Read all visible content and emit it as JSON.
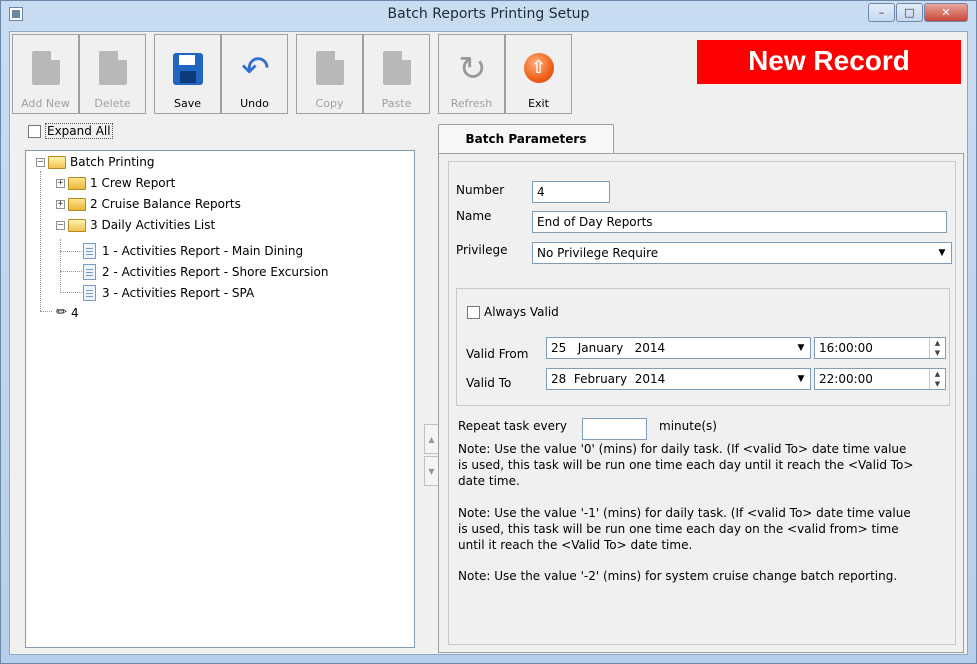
{
  "window": {
    "title": "Batch Reports Printing Setup"
  },
  "toolbar": {
    "buttons": [
      {
        "label": "Add New",
        "icon": "add-new-icon",
        "enabled": false
      },
      {
        "label": "Delete",
        "icon": "delete-icon",
        "enabled": false
      },
      {
        "label": "Save",
        "icon": "save-icon",
        "enabled": true
      },
      {
        "label": "Undo",
        "icon": "undo-icon",
        "enabled": true
      },
      {
        "label": "Copy",
        "icon": "copy-icon",
        "enabled": false
      },
      {
        "label": "Paste",
        "icon": "paste-icon",
        "enabled": false
      },
      {
        "label": "Refresh",
        "icon": "refresh-icon",
        "enabled": false
      },
      {
        "label": "Exit",
        "icon": "exit-icon",
        "enabled": true
      }
    ]
  },
  "status_banner": {
    "text": "New Record",
    "color": "#ff0000"
  },
  "tree_panel": {
    "expand_all_label": "Expand All",
    "root": "Batch Printing",
    "nodes": [
      "1 Crew Report",
      "2 Cruise Balance Reports",
      "3 Daily Activities List",
      "1 - Activities Report - Main Dining",
      "2 - Activities Report - Shore Excursion",
      "3 - Activities Report - SPA",
      "4"
    ]
  },
  "tab": {
    "label": "Batch Parameters"
  },
  "form": {
    "number_label": "Number",
    "number_value": "4",
    "name_label": "Name",
    "name_value": "End of Day Reports",
    "privilege_label": "Privilege",
    "privilege_value": "No Privilege Require",
    "always_valid_label": "Always Valid",
    "valid_from_label": "Valid From",
    "valid_from_date": "25   January   2014",
    "valid_from_time": "16:00:00",
    "valid_to_label": "Valid To",
    "valid_to_date": "28  February  2014",
    "valid_to_time": "22:00:00",
    "repeat_label": "Repeat task every",
    "repeat_value": "",
    "repeat_unit": "minute(s)",
    "note1": "Note: Use the value '0' (mins) for daily task. (If <valid To> date time value is used, this task will be run one time each day until it reach the <Valid To> date time.",
    "note2": "Note: Use the value '-1' (mins) for daily task. (If <valid To> date time value is used, this task will be run one time each day on the <valid from> time until it reach the <Valid To> date time.",
    "note3": "Note: Use the value '-2' (mins) for system cruise change batch reporting."
  }
}
